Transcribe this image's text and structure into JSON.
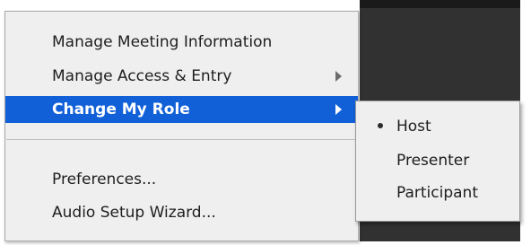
{
  "menu": {
    "items": [
      {
        "label": "Manage Meeting Information"
      },
      {
        "label": "Manage Access & Entry"
      },
      {
        "label": "Change My Role"
      },
      {
        "label": "Preferences..."
      },
      {
        "label": "Audio Setup Wizard..."
      }
    ]
  },
  "submenu": {
    "items": [
      {
        "label": "Host",
        "selected": true
      },
      {
        "label": "Presenter",
        "selected": false
      },
      {
        "label": "Participant",
        "selected": false
      }
    ]
  },
  "colors": {
    "highlight": "#1160d8",
    "menu_background": "#efefef",
    "app_background": "#313131"
  },
  "icons": {
    "submenu_arrow": "chevron-right-icon",
    "selected_marker": "bullet-icon"
  }
}
